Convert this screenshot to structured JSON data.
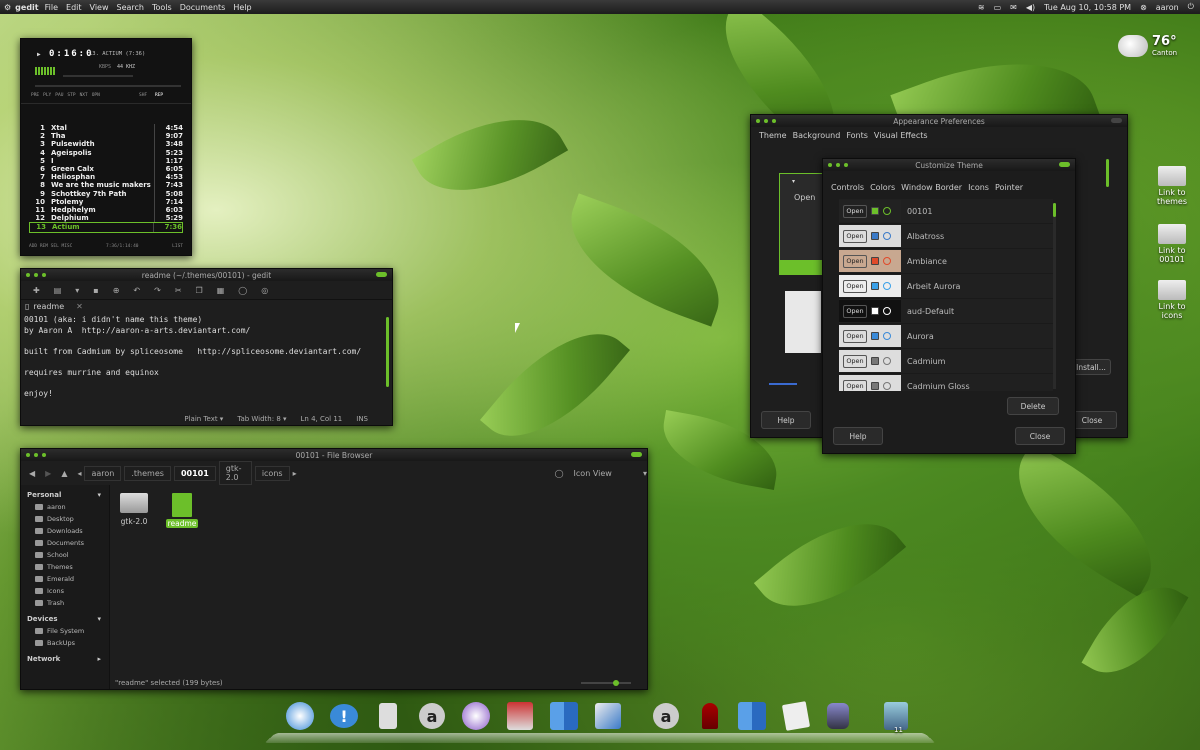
{
  "panel": {
    "app": "gedit",
    "menus": [
      "File",
      "Edit",
      "View",
      "Search",
      "Tools",
      "Documents",
      "Help"
    ],
    "datetime": "Tue Aug 10, 10:58 PM",
    "user": "aaron"
  },
  "weather": {
    "temp": "76°",
    "city": "Canton"
  },
  "player": {
    "time": "0:16:0",
    "track": "13. ACTIUM (7:36)",
    "kbps": "KBPS",
    "khz": "44 KHZ",
    "controls": [
      "PRE",
      "PLY",
      "PAU",
      "STP",
      "NXT",
      "OPN"
    ],
    "shf": "SHF",
    "rep": "REP",
    "playlist": [
      {
        "n": "1",
        "title": "Xtal",
        "len": "4:54"
      },
      {
        "n": "2",
        "title": "Tha",
        "len": "9:07"
      },
      {
        "n": "3",
        "title": "Pulsewidth",
        "len": "3:48"
      },
      {
        "n": "4",
        "title": "Ageispolis",
        "len": "5:23"
      },
      {
        "n": "5",
        "title": "I",
        "len": "1:17"
      },
      {
        "n": "6",
        "title": "Green Calx",
        "len": "6:05"
      },
      {
        "n": "7",
        "title": "Heliosphan",
        "len": "4:53"
      },
      {
        "n": "8",
        "title": "We are the music makers",
        "len": "7:43"
      },
      {
        "n": "9",
        "title": "Schottkey 7th Path",
        "len": "5:08"
      },
      {
        "n": "10",
        "title": "Ptolemy",
        "len": "7:14"
      },
      {
        "n": "11",
        "title": "Hedphelym",
        "len": "6:03"
      },
      {
        "n": "12",
        "title": "Delphium",
        "len": "5:29"
      },
      {
        "n": "13",
        "title": "Actium",
        "len": "7:36"
      }
    ],
    "footer_left": "ADD  REM  SEL  MISC",
    "footer_mid": "7:36/1:14:40",
    "footer_right": "LIST"
  },
  "gedit": {
    "title": "readme (~/.themes/00101) - gedit",
    "tab": "readme",
    "lines": [
      "00101 (aka: i didn't name this theme)",
      "by Aaron A  http://aaron-a-arts.deviantart.com/",
      "",
      "built from Cadmium by spliceosome   http://spliceosome.deviantart.com/",
      "",
      "requires murrine and equinox",
      "",
      "enjoy!"
    ],
    "status_lang": "Plain Text ▾",
    "status_tab": "Tab Width:  8 ▾",
    "status_pos": "Ln 4, Col 11",
    "status_mode": "INS"
  },
  "browser": {
    "title": "00101 - File Browser",
    "crumbs": [
      "aaron",
      ".themes",
      "00101",
      "gtk-2.0",
      "icons"
    ],
    "view": "Icon View",
    "personal": "Personal",
    "places": [
      "aaron",
      "Desktop",
      "Downloads",
      "Documents",
      "School",
      "Themes",
      "Emerald",
      "Icons",
      "Trash"
    ],
    "devices": "Devices",
    "device_items": [
      "File System",
      "BackUps"
    ],
    "network": "Network",
    "files": [
      "gtk-2.0",
      "readme"
    ],
    "status": "\"readme\" selected (199 bytes)"
  },
  "appearance": {
    "title": "Appearance Preferences",
    "tabs": [
      "Theme",
      "Background",
      "Fonts",
      "Visual Effects"
    ],
    "open": "Open",
    "install": "Install...",
    "help": "Help",
    "close": "Close"
  },
  "customize": {
    "title": "Customize Theme",
    "tabs": [
      "Controls",
      "Colors",
      "Window Border",
      "Icons",
      "Pointer"
    ],
    "open_label": "Open",
    "themes": [
      "00101",
      "Albatross",
      "Ambiance",
      "Arbeit Aurora",
      "aud-Default",
      "Aurora",
      "Cadmium",
      "Cadmium Gloss"
    ],
    "delete": "Delete",
    "help": "Help",
    "close": "Close"
  },
  "desktop": [
    "Link to themes",
    "Link to 00101",
    "Link to icons"
  ],
  "dock": {
    "badge": "11"
  }
}
